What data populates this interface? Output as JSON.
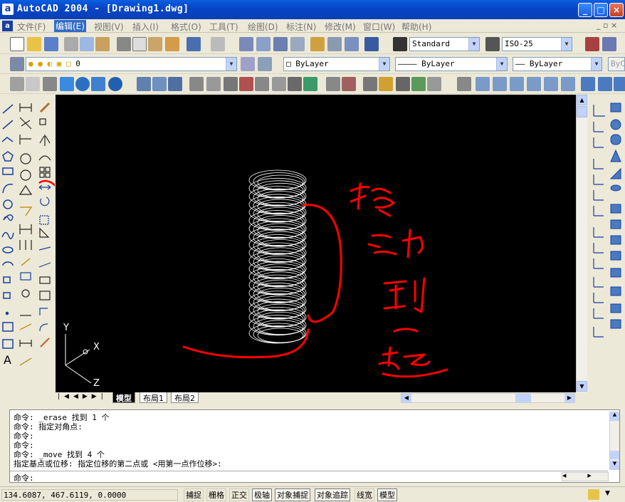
{
  "window": {
    "title": "AutoCAD 2004 - [Drawing1.dwg]",
    "app_icon_letter": "a",
    "minimize": "_",
    "maximize": "□",
    "close": "×"
  },
  "menu": [
    "文件(F)",
    "编辑(E)",
    "视图(V)",
    "插入(I)",
    "格式(O)",
    "工具(T)",
    "绘图(D)",
    "标注(N)",
    "修改(M)",
    "窗口(W)",
    "帮助(H)"
  ],
  "toolbars": {
    "text_style": "Standard",
    "dim_style": "ISO-25",
    "layer": "0",
    "color": "ByLayer",
    "linetype": "ByLayer",
    "lineweight": "ByLayer",
    "plot_style": "ByC"
  },
  "layout_tabs": [
    "模型",
    "布局1",
    "布局2"
  ],
  "ucs": {
    "x": "X",
    "y": "Y",
    "z": "Z"
  },
  "command_history": [
    "命令:  _erase 找到 1 个",
    "命令:  指定对角点:",
    "命令:",
    "命令:",
    "命令:  _move 找到 4 个",
    "指定基点或位移: 指定位移的第二点或 <用第一点作位移>:"
  ],
  "command_prompt": "命令:",
  "status": {
    "coords": "134.6087,  467.6119,  0.0000",
    "buttons": [
      "捕捉",
      "栅格",
      "正交",
      "极轴",
      "对象捕捉",
      "对象追踪",
      "线宽",
      "模型"
    ]
  },
  "colors": {
    "canvas": "#000000",
    "annotation": "#ff0000",
    "spring": "#ffffff",
    "titlebar": "#0a5fe0"
  }
}
